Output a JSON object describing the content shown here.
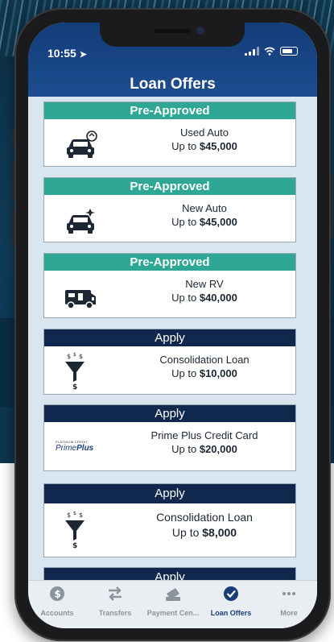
{
  "status": {
    "time": "10:55"
  },
  "header": {
    "title": "Loan Offers"
  },
  "offers": [
    {
      "badge": "Pre-Approved",
      "badge_type": "pre",
      "icon": "used-car-icon",
      "name": "Used Auto",
      "amount_prefix": "Up to ",
      "amount": "$45,000"
    },
    {
      "badge": "Pre-Approved",
      "badge_type": "pre",
      "icon": "new-car-icon",
      "name": "New Auto",
      "amount_prefix": "Up to ",
      "amount": "$45,000"
    },
    {
      "badge": "Pre-Approved",
      "badge_type": "pre",
      "icon": "rv-icon",
      "name": "New RV",
      "amount_prefix": "Up to ",
      "amount": "$40,000"
    },
    {
      "badge": "Apply",
      "badge_type": "apply",
      "icon": "funnel-money-icon",
      "name": "Consolidation Loan",
      "amount_prefix": "Up to ",
      "amount": "$10,000"
    },
    {
      "badge": "Apply",
      "badge_type": "apply",
      "icon": "prime-plus-logo",
      "logo_small": "PLATINUM CREDIT",
      "logo_big": "PrimePlus",
      "name": "Prime Plus Credit Card",
      "amount_prefix": "Up to ",
      "amount": "$20,000"
    },
    {
      "badge": "Apply",
      "badge_type": "apply",
      "icon": "funnel-money-icon",
      "name": "Consolidation Loan",
      "amount_prefix": "Up to ",
      "amount": "$8,000"
    },
    {
      "badge": "Apply",
      "badge_type": "apply",
      "icon": "",
      "name": "",
      "amount_prefix": "",
      "amount": ""
    }
  ],
  "tabbar": {
    "items": [
      {
        "label": "Accounts",
        "icon": "dollar-coin-icon",
        "active": false
      },
      {
        "label": "Transfers",
        "icon": "transfer-arrows-icon",
        "active": false
      },
      {
        "label": "Payment Cen...",
        "icon": "payment-icon",
        "active": false
      },
      {
        "label": "Loan Offers",
        "icon": "check-badge-icon",
        "active": true
      },
      {
        "label": "More",
        "icon": "more-dots-icon",
        "active": false
      }
    ]
  },
  "colors": {
    "preapproved": "#2ea894",
    "apply": "#11284e",
    "header": "#1e4d8f"
  }
}
